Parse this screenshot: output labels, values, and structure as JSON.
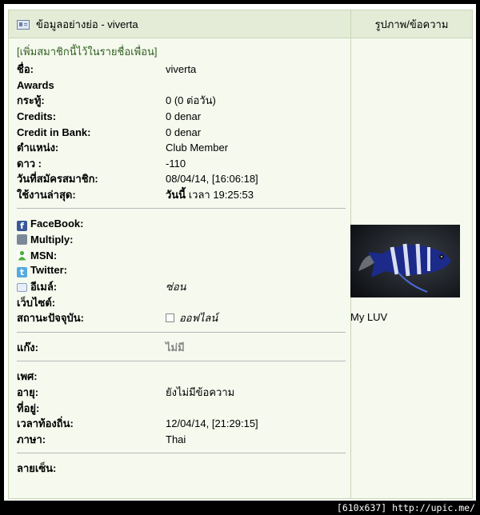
{
  "header": {
    "left_title": "ข้อมูลอย่างย่อ - viverta",
    "right_title": "รูปภาพ/ข้อความ"
  },
  "add_friend_link": "[เพิ่มสมาชิกนี้ไว้ในรายชื่อเพื่อน]",
  "profile": {
    "name_label": "ชื่อ:",
    "name_value": "viverta",
    "awards_label": "Awards",
    "posts_label": "กระทู้:",
    "posts_value": "0 (0 ต่อวัน)",
    "credits_label": "Credits:",
    "credits_value": "0 denar",
    "bank_label": "Credit in Bank:",
    "bank_value": "0 denar",
    "position_label": "ตำแหน่ง:",
    "position_value": "Club Member",
    "stars_label": "ดาว :",
    "stars_value": "-110",
    "joined_label": "วันที่สมัครสมาชิก:",
    "joined_value": "08/04/14, [16:06:18]",
    "last_active_label": "ใช้งานล่าสุด:",
    "last_active_day": "วันนี้",
    "last_active_time": "เวลา 19:25:53"
  },
  "contacts": {
    "facebook_label": "FaceBook:",
    "multiply_label": "Multiply:",
    "msn_label": "MSN:",
    "twitter_label": "Twitter:",
    "email_label": "อีเมล์:",
    "email_value": "ซ่อน",
    "website_label": "เว็บไซต์:",
    "status_label": "สถานะปัจจุบัน:",
    "status_value": "ออฟไลน์"
  },
  "gang": {
    "label": "แก๊ง:",
    "value": "ไม่มี"
  },
  "personal": {
    "gender_label": "เพศ:",
    "age_label": "อายุ:",
    "age_value": "ยังไม่มีข้อความ",
    "location_label": "ที่อยู่:",
    "local_time_label": "เวลาท้องถิ่น:",
    "local_time_value": "12/04/14, [21:29:15]",
    "language_label": "ภาษา:",
    "language_value": "Thai"
  },
  "signature_label": "ลายเซ็น:",
  "avatar_caption": "My LUV",
  "watermark": "[610x637] http://upic.me/",
  "colors": {
    "header_bg": "#e4ecd7",
    "body_bg": "#f5f9ee",
    "border": "#c8d6b7",
    "link": "#2f5f1f"
  },
  "icons": [
    "profile-card-icon",
    "facebook-icon",
    "multiply-icon",
    "msn-icon",
    "twitter-icon",
    "email-icon",
    "checkbox-icon"
  ]
}
